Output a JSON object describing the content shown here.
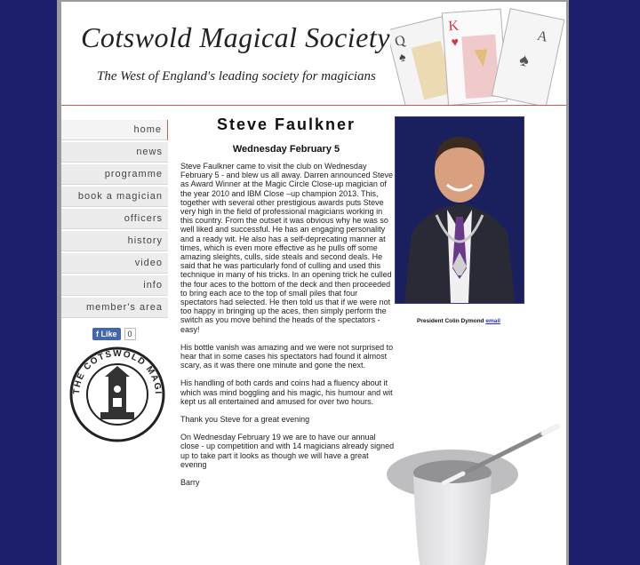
{
  "header": {
    "title": "Cotswold Magical Society",
    "tagline": "The West of England's leading society for magicians"
  },
  "nav": {
    "items": [
      "home",
      "news",
      "programme",
      "book a magician",
      "officers",
      "history",
      "video",
      "info",
      "member's area"
    ]
  },
  "facebook": {
    "like_label": "Like",
    "count": "0"
  },
  "main": {
    "title": "Steve Faulkner",
    "date": "Wednesday February 5",
    "paragraphs": [
      "Steve Faulkner came to visit the club on Wednesday February 5  - and blew us all away. Darren announced Steve as Award Winner at the Magic Circle Close-up magician of the year 2010 and IBM Close –up champion 2013. This, together with several other prestigious awards puts Steve very high in the field of professional magicians working in this country. From the outset it was obvious why he was so well liked and successful. He has an engaging personality and a ready wit. He also has a self-deprecating manner at times, which is even more effective as he pulls off some amazing sleights, culls, side steals and second deals. He said that he was particularly fond of culling and used this technique in many of his tricks. In an opening trick he culled the four aces to the bottom of the deck and then proceeded to bring each ace to the top of small piles that four spectators had selected. He then told us that if we were not too happy in bringing up the aces, then simply perform the switch as you move behind the heads of the spectators  - easy!",
      "His bottle vanish was amazing and we were not surprised to hear that in some cases his spectators had found it almost scary, as it was there one minute and gone the next.",
      "His handling of both cards and coins had a fluency about it which was mind boggling and his magic, his humour and wit kept us all entertained and amused for over two hours.",
      "Thank you Steve for a great evening",
      "On Wednesday February 19 we are to have our annual close - up competition and with 14 magicians already signed up to take part it looks as though we will have a great evenng",
      "Barry"
    ]
  },
  "sidebar_right": {
    "caption": "President Colin Dymond",
    "email_link": "email"
  },
  "colors": {
    "background": "#1d1f6b",
    "accent_rule": "#c45a5a",
    "link": "#2233aa"
  }
}
